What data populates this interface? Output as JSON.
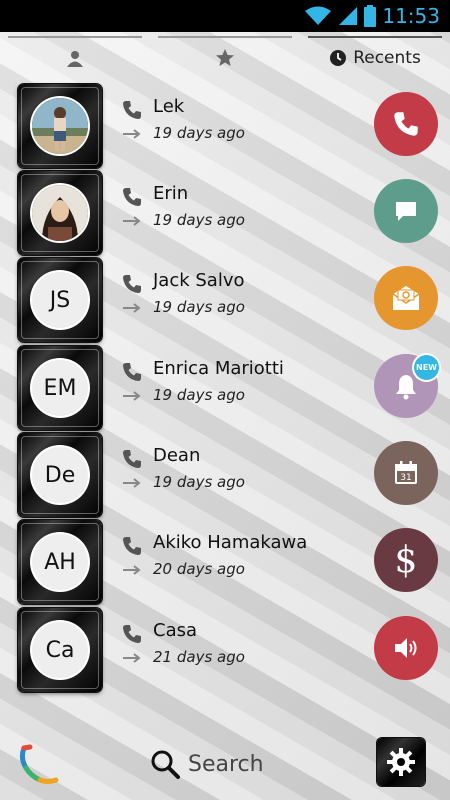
{
  "status_bar": {
    "time": "11:53"
  },
  "tabs": [
    {
      "name": "contacts",
      "label": "",
      "icon": "person-icon"
    },
    {
      "name": "favorites",
      "label": "",
      "icon": "star-icon"
    },
    {
      "name": "recents",
      "label": "Recents",
      "icon": "clock-icon",
      "active": true
    }
  ],
  "contacts": [
    {
      "name": "Lek",
      "time": "19 days ago",
      "initials": "",
      "has_photo": true,
      "action": {
        "icon": "phone-icon",
        "color": "#c23b47"
      }
    },
    {
      "name": "Erin",
      "time": "19 days ago",
      "initials": "",
      "has_photo": true,
      "action": {
        "icon": "message-icon",
        "color": "#5e9d8c"
      }
    },
    {
      "name": "Jack Salvo",
      "time": "19 days ago",
      "initials": "JS",
      "has_photo": false,
      "action": {
        "icon": "email-icon",
        "color": "#e5962e"
      }
    },
    {
      "name": "Enrica Mariotti",
      "time": "19 days ago",
      "initials": "EM",
      "has_photo": false,
      "action": {
        "icon": "bell-icon",
        "color": "#b095b8",
        "badge": "NEW"
      }
    },
    {
      "name": "Dean",
      "time": "19 days ago",
      "initials": "De",
      "has_photo": false,
      "action": {
        "icon": "calendar-icon",
        "color": "#7a645c",
        "calendar_day": "31"
      }
    },
    {
      "name": "Akiko Hamakawa",
      "time": "20 days ago",
      "initials": "AH",
      "has_photo": false,
      "action": {
        "icon": "dollar-icon",
        "color": "#6a3a42",
        "symbol": "$"
      }
    },
    {
      "name": "Casa",
      "time": "21 days ago",
      "initials": "Ca",
      "has_photo": false,
      "action": {
        "icon": "speaker-icon",
        "color": "#c23b47"
      }
    }
  ],
  "bottom_bar": {
    "search_label": "Search"
  }
}
